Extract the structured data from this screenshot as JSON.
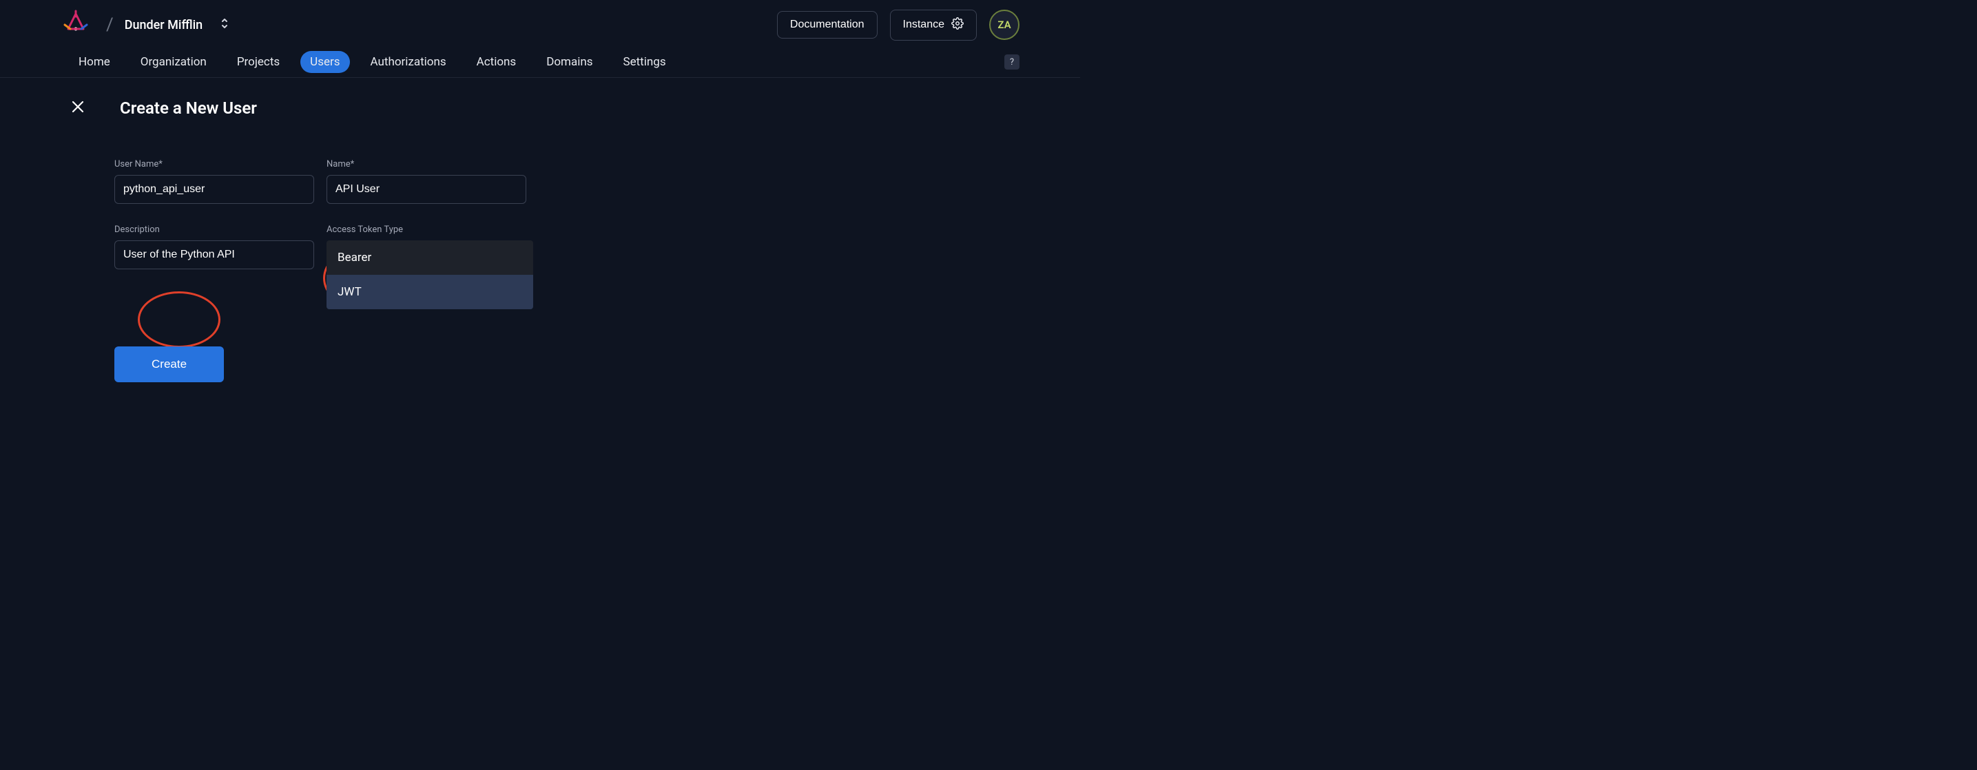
{
  "header": {
    "org_name": "Dunder Mifflin",
    "documentation_label": "Documentation",
    "instance_label": "Instance",
    "avatar_initials": "ZA"
  },
  "nav": {
    "items": [
      {
        "label": "Home"
      },
      {
        "label": "Organization"
      },
      {
        "label": "Projects"
      },
      {
        "label": "Users",
        "active": true
      },
      {
        "label": "Authorizations"
      },
      {
        "label": "Actions"
      },
      {
        "label": "Domains"
      },
      {
        "label": "Settings"
      }
    ],
    "help_label": "?"
  },
  "page": {
    "title": "Create a New User"
  },
  "form": {
    "username_label": "User Name*",
    "username_value": "python_api_user",
    "name_label": "Name*",
    "name_value": "API User",
    "description_label": "Description",
    "description_value": "User of the Python API",
    "token_type_label": "Access Token Type",
    "token_type_options": [
      {
        "label": "Bearer"
      },
      {
        "label": "JWT",
        "selected": true
      }
    ],
    "create_label": "Create"
  }
}
